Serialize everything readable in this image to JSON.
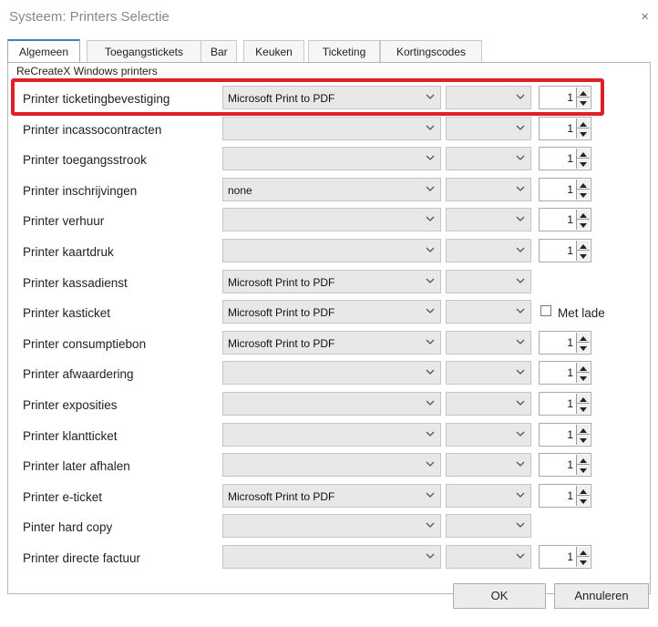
{
  "window": {
    "title": "Systeem: Printers Selectie",
    "close_glyph": "×"
  },
  "tabs": [
    {
      "label": "Algemeen",
      "active": true
    },
    {
      "label": "Toegangstickets"
    },
    {
      "label": "Bar"
    },
    {
      "label": "Keuken"
    },
    {
      "label": "Ticketing"
    },
    {
      "label": "Kortingscodes"
    }
  ],
  "group_label": "ReCreateX Windows printers",
  "rows": [
    {
      "label": "Printer ticketingbevestiging",
      "printer": "Microsoft Print to PDF",
      "copies": "1"
    },
    {
      "label": "Printer incassocontracten",
      "printer": "",
      "copies": "1"
    },
    {
      "label": "Printer toegangsstrook",
      "printer": "",
      "copies": "1"
    },
    {
      "label": "Printer inschrijvingen",
      "printer": "none",
      "copies": "1"
    },
    {
      "label": "Printer verhuur",
      "printer": "",
      "copies": "1"
    },
    {
      "label": "Printer kaartdruk",
      "printer": "",
      "copies": "1"
    },
    {
      "label": "Printer kassadienst",
      "printer": "Microsoft Print to PDF"
    },
    {
      "label": "Printer kasticket",
      "printer": "Microsoft Print to PDF",
      "checkbox_label": "Met lade",
      "checked": false
    },
    {
      "label": "Printer consumptiebon",
      "printer": "Microsoft Print to PDF",
      "copies": "1"
    },
    {
      "label": "Printer afwaardering",
      "printer": "",
      "copies": "1"
    },
    {
      "label": "Printer exposities",
      "printer": "",
      "copies": "1"
    },
    {
      "label": "Printer klantticket",
      "printer": "",
      "copies": "1"
    },
    {
      "label": "Printer later afhalen",
      "printer": "",
      "copies": "1"
    },
    {
      "label": "Printer e-ticket",
      "printer": "Microsoft Print to PDF",
      "copies": "1"
    },
    {
      "label": "Pinter hard copy",
      "printer": ""
    },
    {
      "label": "Printer directe factuur",
      "printer": "",
      "copies": "1"
    }
  ],
  "buttons": {
    "ok": "OK",
    "cancel": "Annuleren"
  },
  "colors": {
    "highlight": "#e01f26",
    "active_tab_accent": "#4a7ebb"
  },
  "icons": {
    "dropdown": "chevron-down-icon",
    "spinner": "spin-up-down-icon",
    "close": "close-icon"
  }
}
